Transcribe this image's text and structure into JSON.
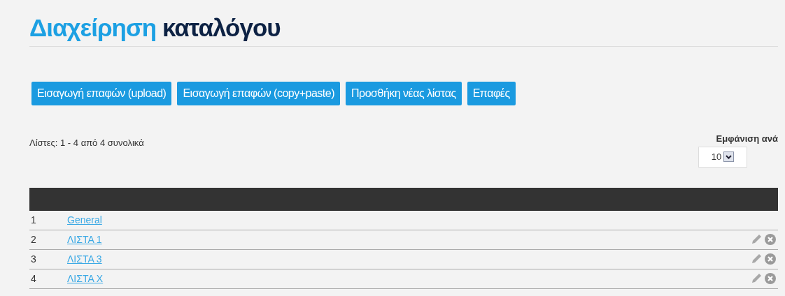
{
  "title": {
    "lead": "Διαχείρηση",
    "rest": "καταλόγου"
  },
  "buttons": [
    "Εισαγωγή επαφών (upload)",
    "Εισαγωγή επαφών (copy+paste)",
    "Προσθήκη νέας λίστας",
    "Επαφές"
  ],
  "summary": "Λίστες: 1 - 4 από 4 συνολικά",
  "page_size": {
    "label": "Εμφάνιση ανά",
    "value": "10"
  },
  "rows": [
    {
      "number": "1",
      "name": "General",
      "actions": false
    },
    {
      "number": "2",
      "name": "ΛΙΣΤΑ 1",
      "actions": true
    },
    {
      "number": "3",
      "name": "ΛΙΣΤΑ 3",
      "actions": true
    },
    {
      "number": "4",
      "name": "ΛΙΣΤΑ X",
      "actions": true
    }
  ]
}
